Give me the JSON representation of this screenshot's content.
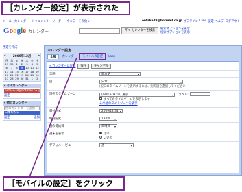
{
  "callouts": {
    "top": "［カレンダー設定］が表示された",
    "bottom": "［モバイルの設定］をクリック"
  },
  "topnav": [
    "メール",
    "カレンダー",
    "ドキュメント",
    "リーダー",
    "ウェブ",
    "その他 ▾"
  ],
  "userbar": {
    "email": "entake28@hotmail.co.jp",
    "links": [
      "オフライン",
      "Labs",
      "設定",
      "ヘルプ",
      "ログアウト"
    ]
  },
  "header": {
    "logo_letters": [
      "G",
      "o",
      "o",
      "g",
      "l",
      "e"
    ],
    "logo_suffix": "カレンダー",
    "search_button": "マイ カレンダーを検索",
    "search_options_1": "検索オプションを表示",
    "search_options_2": "検索オプションを表示"
  },
  "sidebar": {
    "create": "予定を作成",
    "mini_cal_title": "2009年12月",
    "mini_cal_prev": "«",
    "mini_cal_next": "»",
    "weekdays": [
      "日",
      "月",
      "火",
      "水",
      "木",
      "金",
      "土"
    ],
    "days": [
      "29",
      "30",
      "1",
      "2",
      "3",
      "4",
      "5",
      "6",
      "7",
      "8",
      "9",
      "10",
      "11",
      "12",
      "13",
      "14",
      "15",
      "16",
      "17",
      "18",
      "19",
      "20",
      "21",
      "22",
      "23",
      "24",
      "25",
      "26",
      "27",
      "28",
      "29",
      "30",
      "31",
      "1",
      "2"
    ],
    "current_day_index": 10,
    "my_calendars": "▾ マイカレンダー",
    "my_cal_item": "entake28@hotmail.co.jp",
    "my_links": [
      "設定",
      ""
    ],
    "other_calendars": "▾ 他のカレンダー",
    "other_search_placeholder": "他のカレンダーを追加",
    "other_cal_item": "日本の祝日",
    "other_links": [
      "設定",
      "追加"
    ]
  },
  "main": {
    "title": "カレンダー設定",
    "tabs": [
      "全般",
      "カレンダー",
      "モバイルの設定",
      "Labs"
    ],
    "back": "« カレンダーに戻る",
    "save": "保存",
    "cancel": "キャンセル",
    "rows": [
      {
        "label": "言語",
        "value": "日本語"
      },
      {
        "label": "国",
        "value": "日本",
        "note": "(祝日のタイムゾーンを表示するには、別の国を選択してください)"
      },
      {
        "label": "現在のタイムゾーン",
        "value": "(GMT+09:00) 東京",
        "extra_label": "ラベル:",
        "check": "すべてのタイムゾーンを表示します",
        "link": "その他のタイムゾーンを表示"
      },
      {
        "label": "日付形式",
        "value": "2009/12/31"
      },
      {
        "label": "時刻形式",
        "value": "13:00"
      },
      {
        "label": "週の開始日",
        "value": "日曜日"
      },
      {
        "label": "週末を表示",
        "radio_yes": "はい",
        "radio_no": "いいえ"
      },
      {
        "label": "デフォルト ビュー",
        "value": "週"
      }
    ]
  },
  "colors": {
    "callout_border": "#7a2a8c",
    "panel_bg": "#c3d3f2",
    "link": "#1a3ec8"
  }
}
